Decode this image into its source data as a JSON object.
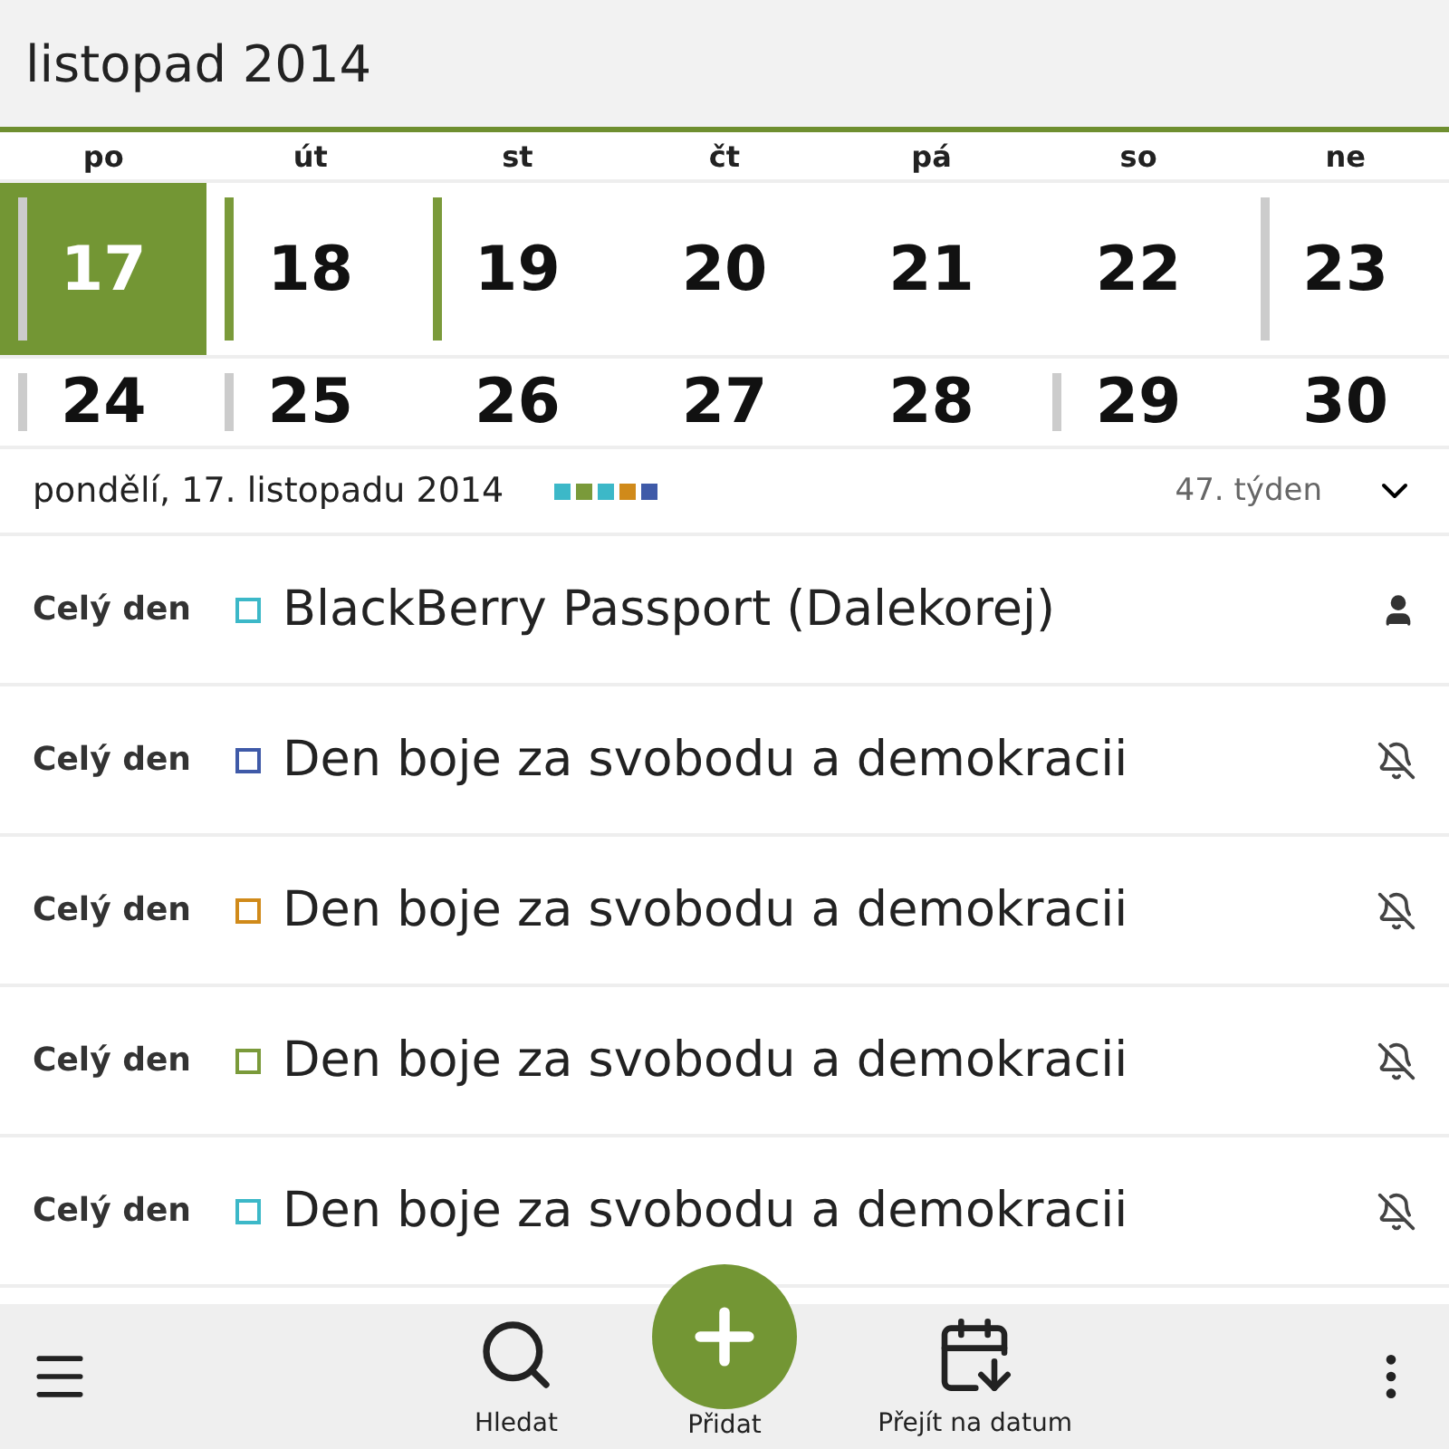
{
  "header": {
    "title": "listopad 2014"
  },
  "weekdays": [
    "po",
    "út",
    "st",
    "čt",
    "pá",
    "so",
    "ne"
  ],
  "weeks": [
    {
      "days": [
        {
          "number": "17",
          "selected": true,
          "markers": [
            {
              "color": "#cccccc"
            }
          ]
        },
        {
          "number": "18",
          "selected": false,
          "markers": [
            {
              "color": "#7a9a3a"
            }
          ]
        },
        {
          "number": "19",
          "selected": false,
          "markers": [
            {
              "color": "#7a9a3a"
            }
          ]
        },
        {
          "number": "20",
          "selected": false
        },
        {
          "number": "21",
          "selected": false
        },
        {
          "number": "22",
          "selected": false
        },
        {
          "number": "23",
          "selected": false,
          "markers": [
            {
              "color": "#cccccc"
            }
          ]
        }
      ]
    },
    {
      "days": [
        {
          "number": "24",
          "selected": false,
          "markers": [
            {
              "color": "#cccccc"
            }
          ]
        },
        {
          "number": "25",
          "selected": false,
          "markers": [
            {
              "color": "#cccccc"
            }
          ]
        },
        {
          "number": "26",
          "selected": false
        },
        {
          "number": "27",
          "selected": false
        },
        {
          "number": "28",
          "selected": false
        },
        {
          "number": "29",
          "selected": false,
          "markers": [
            {
              "color": "#cccccc"
            }
          ]
        },
        {
          "number": "30",
          "selected": false
        }
      ]
    }
  ],
  "date_bar": {
    "date": "pondělí, 17. listopadu 2014",
    "calendars": [
      {
        "color": "#3cb8c8"
      },
      {
        "color": "#7a9a3a"
      },
      {
        "color": "#3cb8c8"
      },
      {
        "color": "#d08a1a"
      },
      {
        "color": "#3f5aa8"
      }
    ],
    "week": "47. týden",
    "expanded": false
  },
  "events": [
    {
      "time": "Celý den",
      "color": "#3cb8c8",
      "title": "BlackBerry Passport (Dalekorej)",
      "kind": "person"
    },
    {
      "time": "Celý den",
      "color": "#3f5aa8",
      "title": "Den boje za svobodu a demokracii",
      "kind": "muted"
    },
    {
      "time": "Celý den",
      "color": "#d08a1a",
      "title": "Den boje za svobodu a demokracii",
      "kind": "muted"
    },
    {
      "time": "Celý den",
      "color": "#7a9a3a",
      "title": "Den boje za svobodu a demokracii",
      "kind": "muted"
    },
    {
      "time": "Celý den",
      "color": "#3cb8c8",
      "title": "Den boje za svobodu a demokracii",
      "kind": "muted"
    }
  ],
  "toolbar": {
    "actions": [
      {
        "label": "Hledat",
        "kind": "search"
      },
      {
        "label": "Přidat",
        "kind": "add"
      },
      {
        "label": "Přejít na datum",
        "kind": "goto"
      }
    ]
  }
}
